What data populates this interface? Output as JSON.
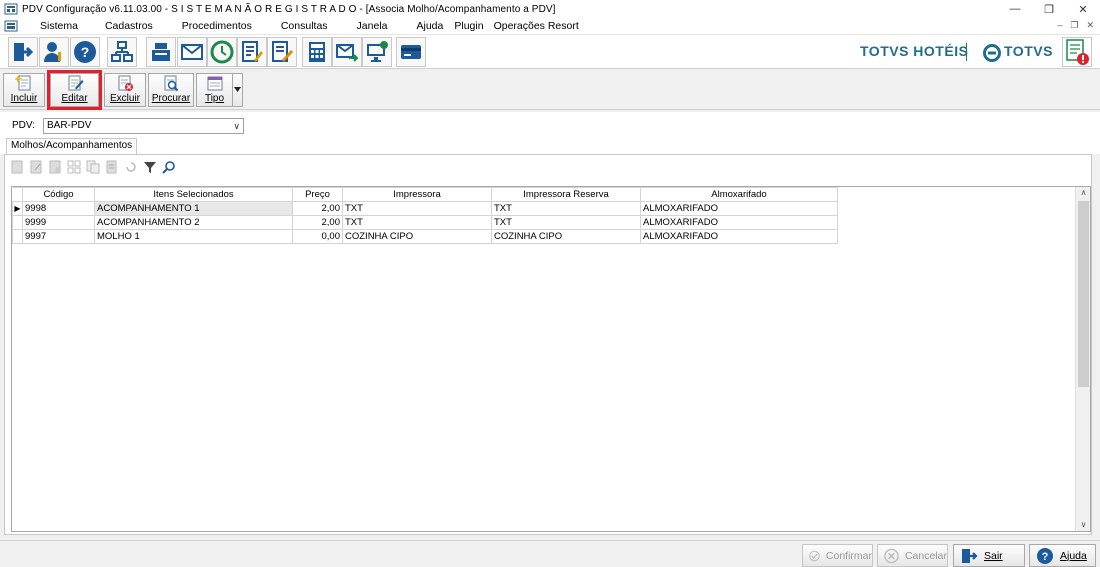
{
  "window": {
    "title": "PDV Configuração v6.11.03.00 - S I S T E M A  N Ã O  R E G I S T R A D O  - [Associa Molho/Acompanhamento a PDV]"
  },
  "menu": [
    "Sistema",
    "Cadastros",
    "Procedimentos",
    "Consultas",
    "Janela",
    "Ajuda",
    "Plugin",
    "Operações Resort"
  ],
  "brand": {
    "left": "TOTVS HOTÉIS",
    "right": "TOTVS"
  },
  "actions": {
    "incluir": "Incluir",
    "editar": "Editar",
    "excluir": "Excluir",
    "procurar": "Procurar",
    "tipo": "Tipo"
  },
  "pdv": {
    "label": "PDV:",
    "value": "BAR-PDV"
  },
  "tab": "Molhos/Acompanhamentos",
  "grid": {
    "columns": [
      "Código",
      "Itens Selecionados",
      "Preço",
      "Impressora",
      "Impressora Reserva",
      "Almoxarifado"
    ],
    "rows": [
      [
        "9998",
        "ACOMPANHAMENTO 1",
        "2,00",
        "TXT",
        "TXT",
        "ALMOXARIFADO"
      ],
      [
        "9999",
        "ACOMPANHAMENTO 2",
        "2,00",
        "TXT",
        "TXT",
        "ALMOXARIFADO"
      ],
      [
        "9997",
        "MOLHO 1",
        "0,00",
        "COZINHA CIPO",
        "COZINHA CIPO",
        "ALMOXARIFADO"
      ]
    ]
  },
  "footer": {
    "confirmar": "Confirmar",
    "cancelar": "Cancelar",
    "sair": "Sair",
    "ajuda": "Ajuda"
  },
  "colors": {
    "brand": "#1f6e8a",
    "highlight": "#e0202a",
    "icon_blue": "#1c5a9c"
  }
}
